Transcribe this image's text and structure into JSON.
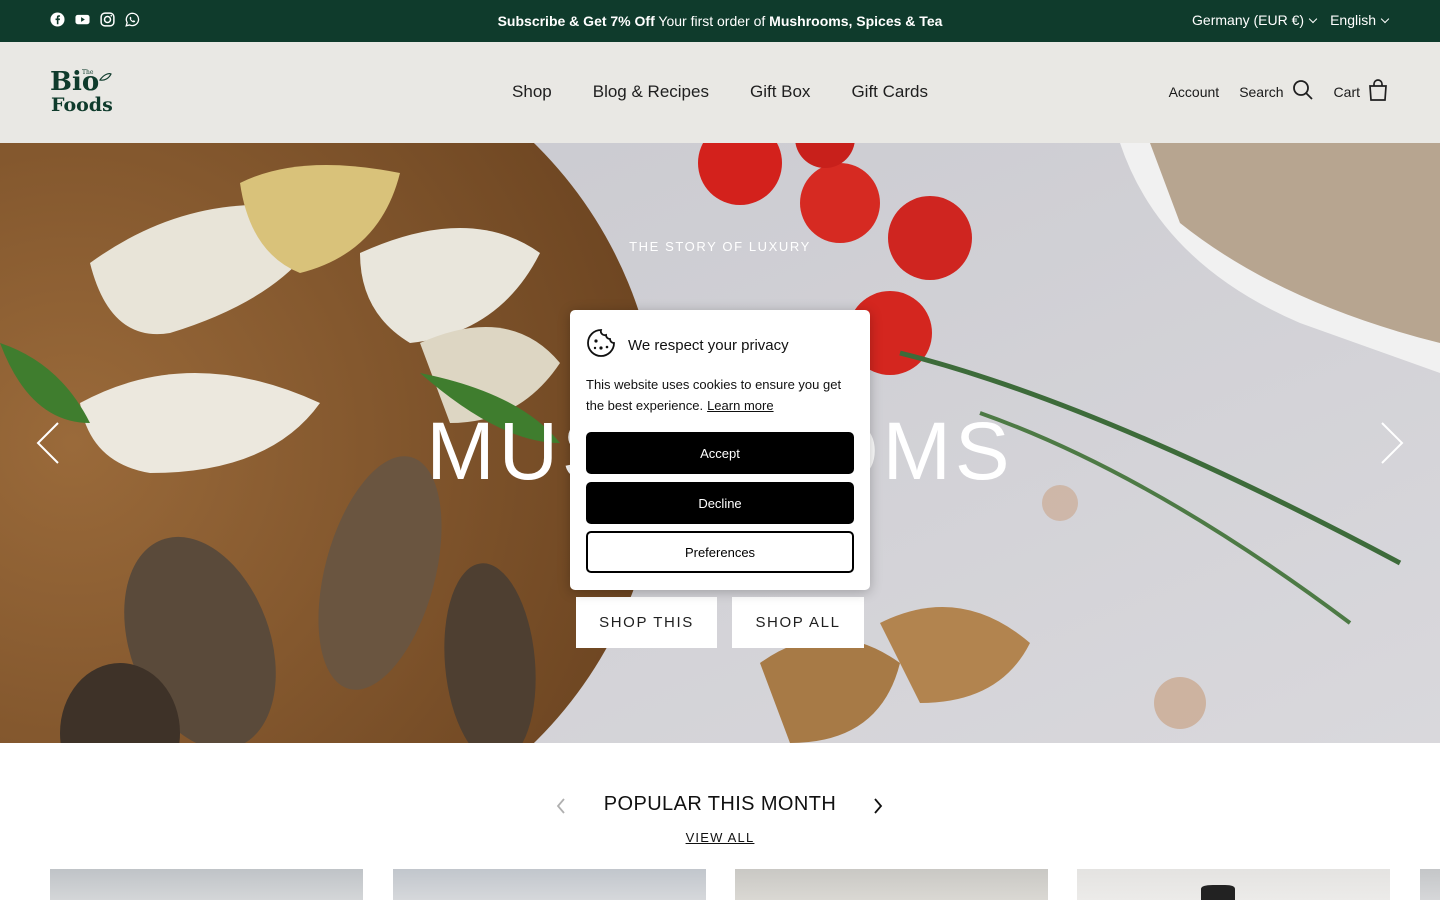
{
  "announcement": {
    "social_icons": [
      "facebook-icon",
      "youtube-icon",
      "instagram-icon",
      "whatsapp-icon"
    ],
    "promo_bold_1": "Subscribe & Get 7% Off",
    "promo_text": " Your first order of ",
    "promo_bold_2": "Mushrooms, Spices & Tea",
    "country": "Germany (EUR €)",
    "language": "English",
    "bg_color": "#0f3b2c"
  },
  "header": {
    "logo_text": "The Bio Foods",
    "nav": [
      "Shop",
      "Blog & Recipes",
      "Gift Box",
      "Gift Cards"
    ],
    "account_label": "Account",
    "search_label": "Search",
    "cart_label": "Cart",
    "bg_color": "#e9e8e4"
  },
  "hero": {
    "subtitle": "THE STORY OF LUXURY",
    "title": "MUSHROOMS",
    "cta_primary": "SHOP THIS",
    "cta_secondary": "SHOP ALL",
    "prev_icon": "chevron-left-icon",
    "next_icon": "chevron-right-icon"
  },
  "cookie": {
    "title": "We respect your privacy",
    "text": "This website uses cookies to ensure you get the best experience.",
    "learn_more": "Learn more",
    "accept": "Accept",
    "decline": "Decline",
    "preferences": "Preferences"
  },
  "popular": {
    "title": "POPULAR THIS MONTH",
    "view_all": "VIEW ALL"
  }
}
